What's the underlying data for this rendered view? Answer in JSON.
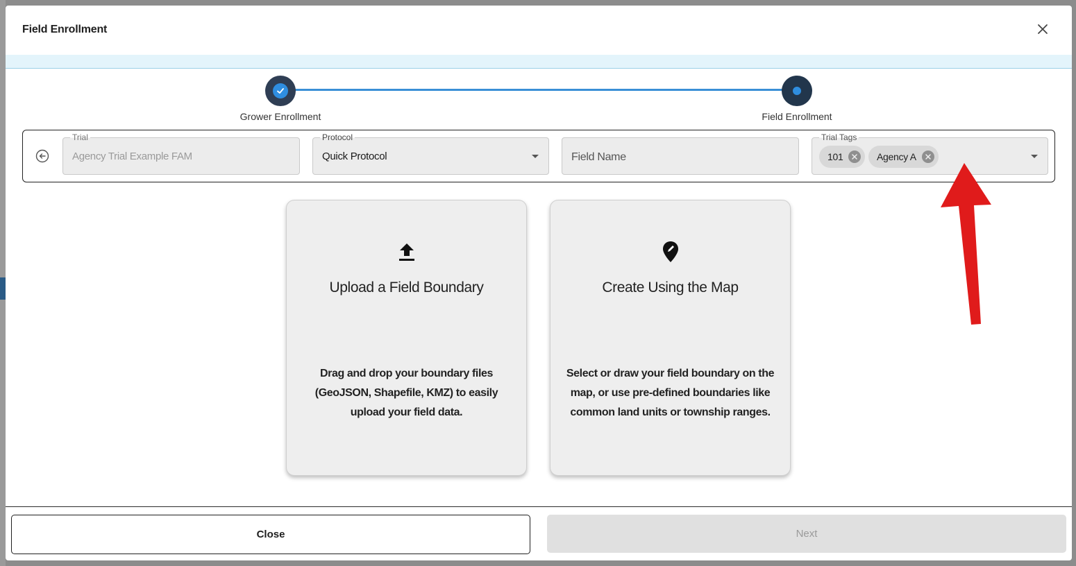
{
  "modal": {
    "title": "Field Enrollment"
  },
  "stepper": {
    "steps": [
      {
        "label": "Grower Enrollment",
        "state": "complete"
      },
      {
        "label": "Field Enrollment",
        "state": "active"
      }
    ]
  },
  "form": {
    "trial": {
      "legend": "Trial",
      "value": "Agency Trial Example FAM"
    },
    "protocol": {
      "legend": "Protocol",
      "value": "Quick Protocol"
    },
    "field_name": {
      "placeholder": "Field Name"
    },
    "trial_tags": {
      "legend": "Trial Tags",
      "chips": [
        "101",
        "Agency A"
      ]
    }
  },
  "cards": [
    {
      "icon": "upload-icon",
      "title": "Upload a Field Boundary",
      "description": "Drag and drop your boundary files (GeoJSON, Shapefile, KMZ) to easily upload your field data."
    },
    {
      "icon": "map-pin-edit-icon",
      "title": "Create Using the Map",
      "description": "Select or draw your field boundary on the map, or use pre-defined boundaries like common land units or township ranges."
    }
  ],
  "footer": {
    "close_label": "Close",
    "next_label": "Next"
  },
  "colors": {
    "step_line": "#3a8fd6",
    "step_node": "#22364c",
    "info_bar": "#e3f4fb",
    "annotation_arrow": "#e01b1b"
  }
}
